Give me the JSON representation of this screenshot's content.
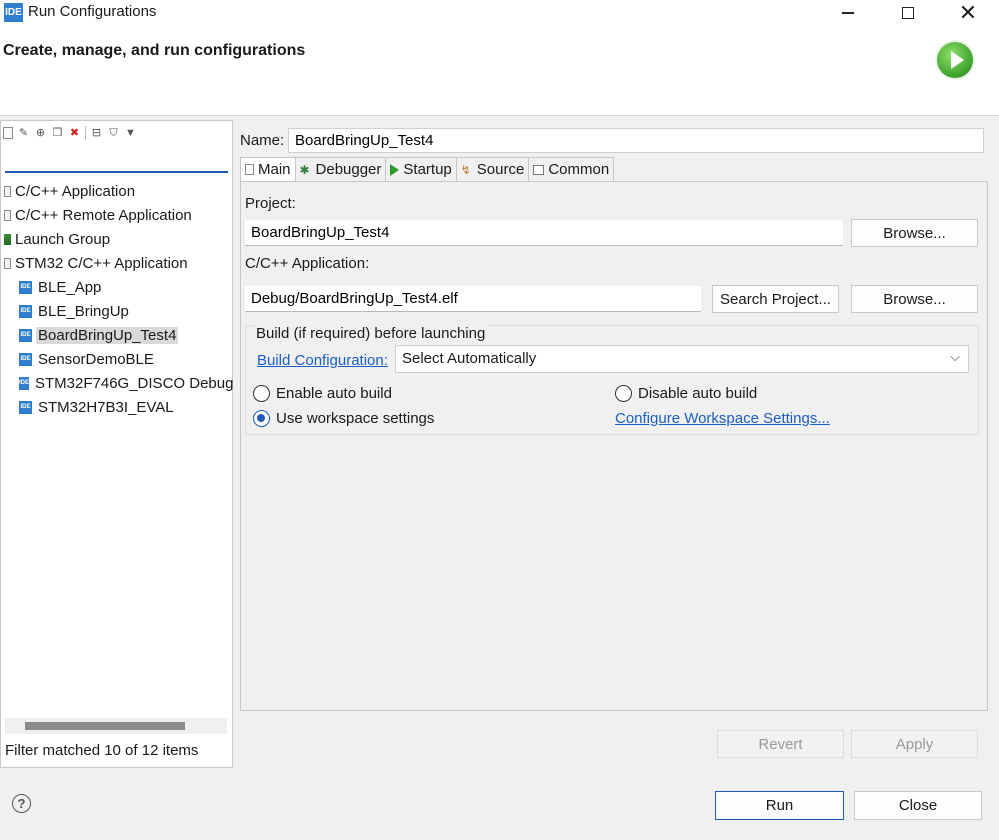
{
  "window": {
    "badge": "IDE",
    "title": "Run Configurations"
  },
  "header": {
    "title": "Create, manage, and run configurations"
  },
  "left": {
    "filter_value": "",
    "tree": [
      {
        "label": "C/C++ Application",
        "kind": "category"
      },
      {
        "label": "C/C++ Remote Application",
        "kind": "category"
      },
      {
        "label": "Launch Group",
        "kind": "launch"
      },
      {
        "label": "STM32 C/C++ Application",
        "kind": "category"
      },
      {
        "label": "BLE_App",
        "kind": "config"
      },
      {
        "label": "BLE_BringUp",
        "kind": "config"
      },
      {
        "label": "BoardBringUp_Test4",
        "kind": "config",
        "selected": true
      },
      {
        "label": "SensorDemoBLE",
        "kind": "config"
      },
      {
        "label": "STM32F746G_DISCO Debug",
        "kind": "config"
      },
      {
        "label": "STM32H7B3I_EVAL",
        "kind": "config"
      }
    ],
    "status": "Filter matched 10 of 12 items"
  },
  "config": {
    "name_label": "Name:",
    "name_value": "BoardBringUp_Test4",
    "tabs": [
      "Main",
      "Debugger",
      "Startup",
      "Source",
      "Common"
    ],
    "project_label": "Project:",
    "project_value": "BoardBringUp_Test4",
    "browse_label": "Browse...",
    "app_label": "C/C++ Application:",
    "app_value": "Debug/BoardBringUp_Test4.elf",
    "search_label": "Search Project...",
    "build_group_title": "Build (if required) before launching",
    "build_config_link": "Build Configuration:",
    "build_config_value": "Select Automatically",
    "enable_auto_build": "Enable auto build",
    "disable_auto_build": "Disable auto build",
    "use_workspace": "Use workspace settings",
    "configure_workspace_link": "Configure Workspace Settings...",
    "revert_label": "Revert",
    "apply_label": "Apply"
  },
  "footer": {
    "run_label": "Run",
    "close_label": "Close",
    "help_glyph": "?"
  },
  "colors": {
    "accent": "#1e5bb8",
    "ide_badge": "#2f7fd1",
    "link": "#1a5fc2"
  }
}
